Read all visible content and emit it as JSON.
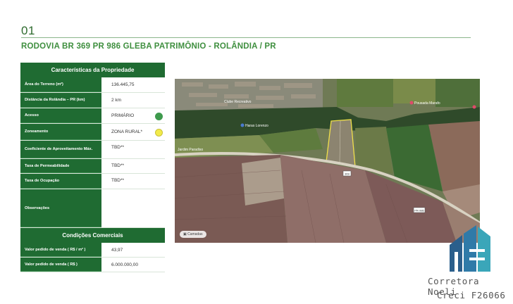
{
  "slide": {
    "number": "01",
    "title": "RODOVIA BR 369 PR 986 GLEBA PATRIMÔNIO - ROLÂNDIA / PR"
  },
  "property_table": {
    "header": "Características da Propriedade",
    "rows": [
      {
        "label": "Área do Terreno (m²)",
        "value": "136.445,75"
      },
      {
        "label": "Distância da Rolândia – PR (km)",
        "value": "2 km"
      },
      {
        "label": "Acesso",
        "value": "PRIMÁRIO",
        "indicator_color": "#3e9a4d"
      },
      {
        "label": "Zoneamento",
        "value": "ZONA RURAL*",
        "indicator_color": "#f2ea4a"
      },
      {
        "label": "Coeficiente de Aproveitamento Máx.",
        "value": "TBD**"
      },
      {
        "label": "Taxa de Permeabilidade",
        "value": "TBD**"
      },
      {
        "label": "Taxa de Ocupação",
        "value": "TBD**"
      },
      {
        "label": "Observações",
        "value": ""
      }
    ]
  },
  "commercial_table": {
    "header": "Condições Comerciais",
    "rows": [
      {
        "label": "Valor pedido de venda ( R$ / m² )",
        "value": "43,97"
      },
      {
        "label": "Valor pedido de venda ( R$ )",
        "value": "6.000.000,00"
      }
    ]
  },
  "map": {
    "attribution": "Camadas",
    "labels": {
      "pousada": "Pousada Marafo",
      "harasi": "Haras Lorenzo",
      "clube": "Clube Recreativo",
      "parque": "Jardim Paradiso",
      "road_shield_1": "369",
      "road_shield_2": "PR-986"
    },
    "icons": [
      "pin-icon",
      "layers-icon"
    ]
  },
  "brand": {
    "name": "Corretora Noeli",
    "creci": "Creci F26066",
    "colors": {
      "primary": "#1f6b32",
      "logo_blue": "#2b5f8c",
      "logo_teal": "#3aa6b9"
    }
  }
}
